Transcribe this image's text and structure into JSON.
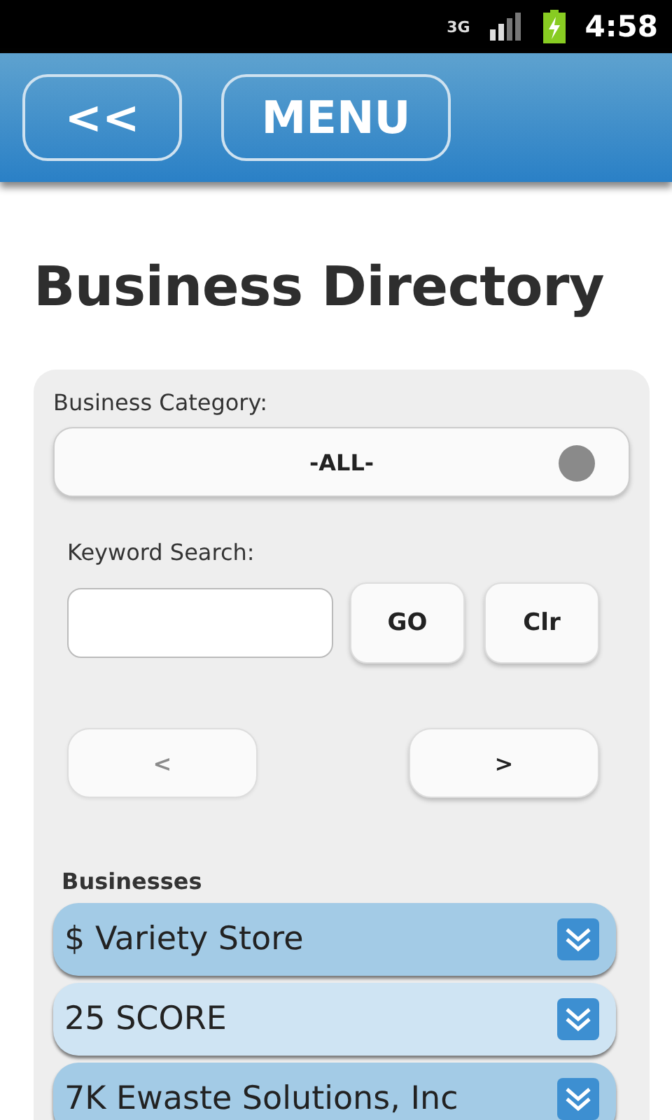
{
  "status_bar": {
    "network": "3G",
    "time": "4:58"
  },
  "header": {
    "buttons": [
      {
        "label": "<<"
      },
      {
        "label": "MENU"
      }
    ]
  },
  "title": "Business Directory",
  "form": {
    "category_label": "Business Category:",
    "category_value": "-ALL-",
    "keyword_label": "Keyword Search:",
    "search_buttons": [
      "GO",
      "Clr"
    ],
    "pager": [
      {
        "label": "<",
        "disabled": true
      },
      {
        "label": ">",
        "disabled": false
      }
    ]
  },
  "businesses": {
    "heading": "Businesses",
    "items": [
      {
        "name": "$ Variety Store",
        "color": "#a3cbe6"
      },
      {
        "name": "25 SCORE",
        "color": "#cfe4f3"
      },
      {
        "name": "7K Ewaste Solutions, Inc",
        "color": "#a3cbe6"
      }
    ]
  }
}
